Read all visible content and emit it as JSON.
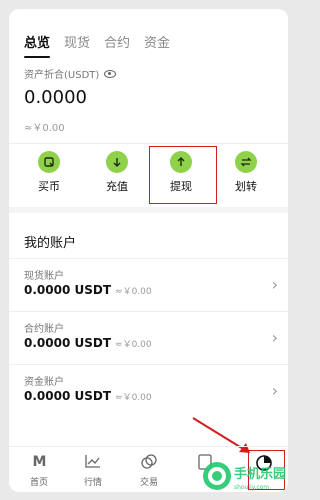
{
  "tabs": [
    {
      "label": "总览",
      "active": true
    },
    {
      "label": "现货",
      "active": false
    },
    {
      "label": "合约",
      "active": false
    },
    {
      "label": "资金",
      "active": false
    }
  ],
  "assets": {
    "label": "资产折合(USDT)",
    "total": "0.0000",
    "approx": "≈￥0.00"
  },
  "actions": [
    {
      "label": "买币",
      "icon": "receipt-icon"
    },
    {
      "label": "充值",
      "icon": "arrow-down-icon"
    },
    {
      "label": "提现",
      "icon": "arrow-up-icon"
    },
    {
      "label": "划转",
      "icon": "swap-icon"
    }
  ],
  "section_title": "我的账户",
  "accounts": [
    {
      "name": "现货账户",
      "amount": "0.0000 USDT",
      "approx": "≈￥0.00"
    },
    {
      "name": "合约账户",
      "amount": "0.0000 USDT",
      "approx": "≈￥0.00"
    },
    {
      "name": "资金账户",
      "amount": "0.0000 USDT",
      "approx": "≈￥0.00"
    }
  ],
  "bottom_nav": [
    {
      "label": "首页",
      "icon": "m-logo-icon"
    },
    {
      "label": "行情",
      "icon": "chart-icon"
    },
    {
      "label": "交易",
      "icon": "trade-icon"
    },
    {
      "label": "",
      "icon": "wallet-icon"
    },
    {
      "label": "",
      "icon": "assets-pie-icon"
    }
  ],
  "watermark": {
    "text": "手机乐园",
    "domain": "shoujiy.com",
    "brand_color": "#27c96f"
  },
  "colors": {
    "accent": "#8fd14a",
    "highlight": "#d11d1d"
  }
}
